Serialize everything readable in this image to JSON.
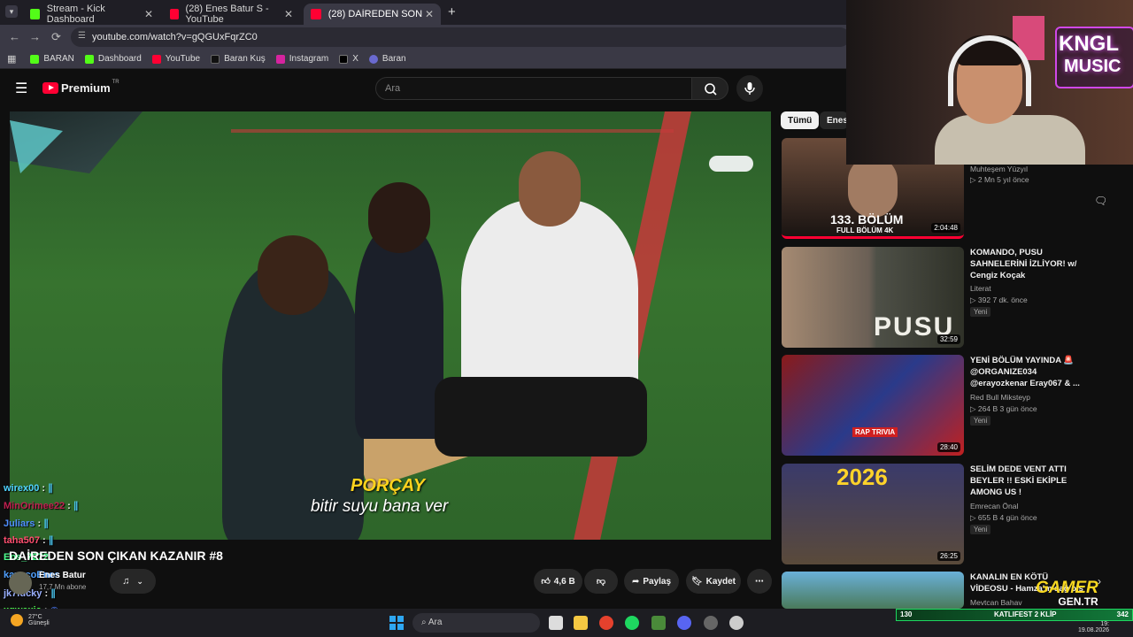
{
  "browser": {
    "tabs": [
      {
        "title": "Stream - Kick Dashboard",
        "color": "#53fc18"
      },
      {
        "title": "(28) Enes Batur S - YouTube",
        "color": "#ff0033"
      },
      {
        "title": "(28) DAİREDEN SON ÇIKAN KA",
        "color": "#ff0033"
      }
    ],
    "url": "youtube.com/watch?v=gQGUxFqrZC0",
    "bookmarks": [
      "BARAN",
      "Dashboard",
      "YouTube",
      "Baran Kuş",
      "Instagram",
      "X",
      "Baran"
    ]
  },
  "youtube": {
    "logo_text": "Premium",
    "logo_sup": "TR",
    "search_placeholder": "Ara",
    "subtitle_name": "PORÇAY",
    "subtitle_text": "bitir suyu bana ver",
    "video_title": "DAİREDEN SON ÇIKAN KAZANIR #8",
    "channel_name": "Enes Batur",
    "channel_subs": "17,7 Mn abone",
    "like_count": "4,6 B",
    "share_label": "Paylaş",
    "save_label": "Kaydet",
    "chips": [
      "Tümü",
      "Enes"
    ],
    "recommendations": [
      {
        "title": "",
        "channel": "Muhteşem Yüzyıl",
        "meta": "2 Mn  5 yıl önce",
        "duration": "2:04:48",
        "thumb_text": "133. BÖLÜM",
        "thumb_sub": "FULL BÖLÜM 4K",
        "new": ""
      },
      {
        "title": "KOMANDO, PUSU SAHNELERİNİ İZLİYOR! w/ Cengiz Koçak",
        "channel": "Literat",
        "meta": "392  7 dk. önce",
        "duration": "32:59",
        "thumb_text": "PUSU",
        "thumb_sub": "",
        "new": "Yeni"
      },
      {
        "title": "YENİ BÖLÜM YAYINDA 🚨 @ORGANIZE034 @erayozkenar Eray067 & ...",
        "channel": "Red Bull Mikstеyp",
        "meta": "264 B  3 gün önce",
        "duration": "28:40",
        "thumb_text": "RAP TRIVIA",
        "thumb_sub": "",
        "new": "Yeni"
      },
      {
        "title": "SELİM DEDE VENT ATTI BEYLER !! ESKİ EKİPLE AMONG US !",
        "channel": "Emrecan Önal",
        "meta": "655 B  4 gün önce",
        "duration": "26:25",
        "thumb_text": "2026",
        "thumb_sub": "",
        "new": "Yeni"
      },
      {
        "title": "KANALIN EN KÖTÜ VİDEOSU - Hamza'm sağ ols",
        "channel": "Mevtcan Bahav",
        "meta": "",
        "duration": "",
        "thumb_text": "",
        "thumb_sub": "",
        "new": ""
      }
    ]
  },
  "chat": [
    {
      "user": "wirex00",
      "color": "#4fd3ff"
    },
    {
      "user": "MinOrimee22",
      "color": "#c02050"
    },
    {
      "user": "Juliars",
      "color": "#4f8fff"
    },
    {
      "user": "taha507",
      "color": "#ff4f6f"
    },
    {
      "user": "Ens_7272",
      "color": "#4fff8f"
    },
    {
      "user": "kayacoEnes",
      "color": "#4fa0ff"
    },
    {
      "user": "jk7lucky",
      "color": "#9ab0ff"
    },
    {
      "user": "xqwexia",
      "color": "#4fff4f"
    }
  ],
  "overlay": {
    "brand_top": "KNGL",
    "brand_bottom": "MUSIC",
    "gamer_top": "GAMER",
    "gamer_bottom": "GEN.TR",
    "stream_label": "KATLIFEST 2 KLİP",
    "counter_left": "130",
    "counter_right": "342"
  },
  "taskbar": {
    "weather_temp": "27°C",
    "weather_desc": "Güneşli",
    "search": "Ara",
    "time": "19:",
    "date": "19.08.2026"
  }
}
